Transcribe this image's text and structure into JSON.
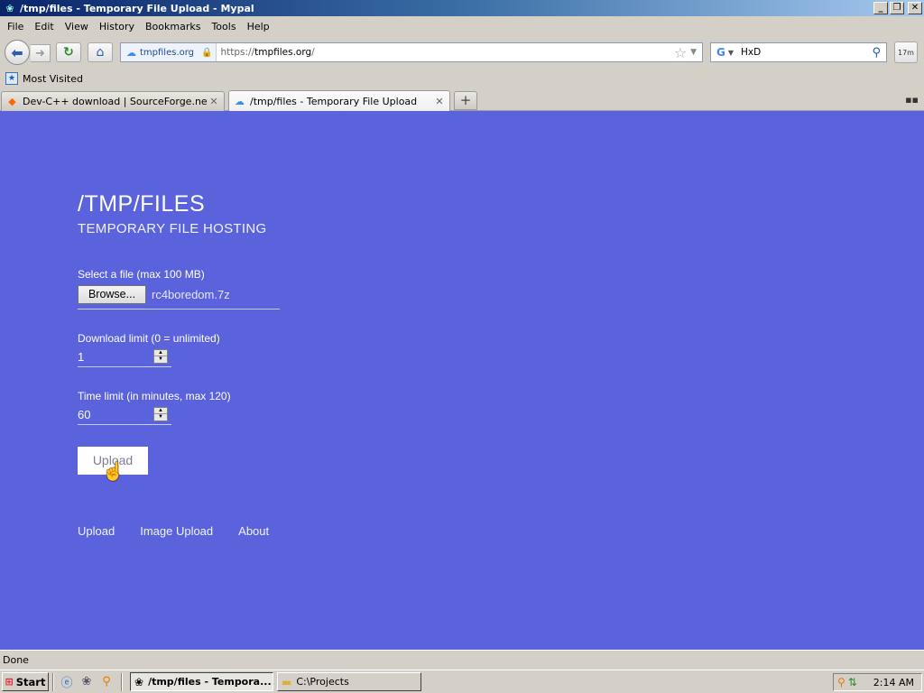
{
  "window": {
    "title": "/tmp/files - Temporary File Upload - Mypal",
    "controls": {
      "minimize": "_",
      "restore": "❐",
      "close": "✕"
    }
  },
  "menubar": {
    "items": [
      "File",
      "Edit",
      "View",
      "History",
      "Bookmarks",
      "Tools",
      "Help"
    ]
  },
  "navbar": {
    "identity": "tmpfiles.org",
    "url_scheme": "https://",
    "url_domain": "tmpfiles.org",
    "url_path": "/",
    "search_engine": "G",
    "search_value": "HxD",
    "extension_label": "17m"
  },
  "bookmarks": {
    "items": [
      {
        "label": "Most Visited"
      }
    ]
  },
  "tabs": [
    {
      "label": "Dev-C++ download | SourceForge.net",
      "active": false
    },
    {
      "label": "/tmp/files - Temporary File Upload",
      "active": true
    }
  ],
  "page": {
    "title": "/TMP/FILES",
    "subtitle": "TEMPORARY FILE HOSTING",
    "file_label": "Select a file (max 100 MB)",
    "browse_label": "Browse...",
    "file_name": "rc4boredom.7z",
    "download_limit_label": "Download limit (0 = unlimited)",
    "download_limit_value": "1",
    "time_limit_label": "Time limit (in minutes, max 120)",
    "time_limit_value": "60",
    "upload_label": "Upload",
    "footer_links": [
      "Upload",
      "Image Upload",
      "About"
    ],
    "background_color": "#5a63dc"
  },
  "status": {
    "text": "Done"
  },
  "taskbar": {
    "start_label": "Start",
    "tasks": [
      {
        "label": "/tmp/files - Tempora...",
        "active": true
      },
      {
        "label": "C:\\Projects",
        "active": false
      }
    ],
    "clock": "2:14 AM"
  }
}
